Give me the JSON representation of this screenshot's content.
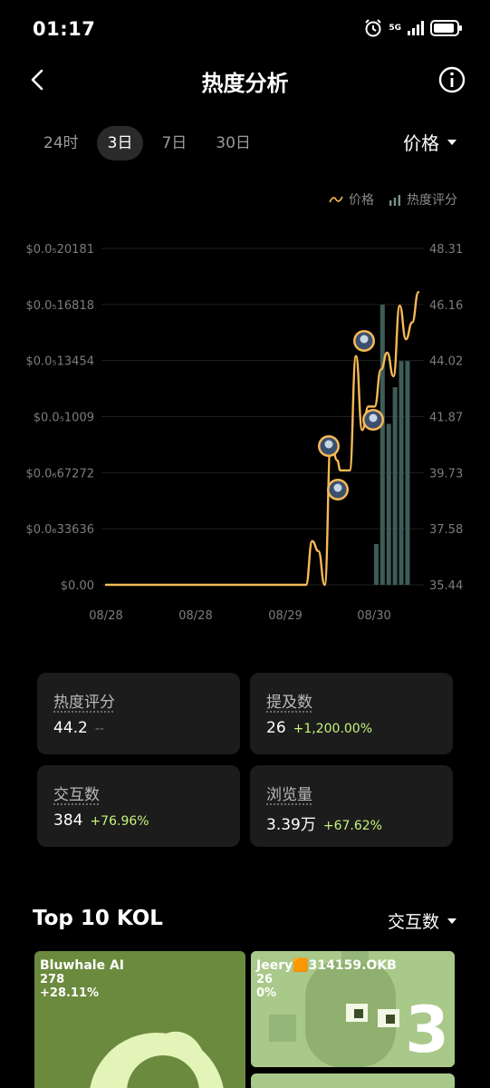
{
  "status_bar": {
    "time": "01:17",
    "network": "5G"
  },
  "header": {
    "title": "热度分析"
  },
  "tabs": [
    "24时",
    "3日",
    "7日",
    "30日"
  ],
  "active_tab": "3日",
  "price_select": {
    "label": "价格"
  },
  "legend": {
    "price": "价格",
    "heat": "热度评分"
  },
  "colors": {
    "price_line": "#F7B955",
    "heat_bar": "#3E5C57",
    "positive": "#C5F37A",
    "kol_card_1": "#6B8A3D",
    "kol_card_2": "#A9C98A"
  },
  "chart_data": {
    "type": "line",
    "x_tick_labels": [
      "08/28",
      "08/28",
      "08/29",
      "08/30"
    ],
    "y_left_labels": [
      "$0.0₅20181",
      "$0.0₅16818",
      "$0.0₅13454",
      "$0.0₅1009",
      "$0.0₆67272",
      "$0.0₆33636",
      "$0.00"
    ],
    "y_right_labels": [
      "48.31",
      "46.16",
      "44.02",
      "41.87",
      "39.73",
      "37.58",
      "35.44"
    ],
    "y_right_range": [
      35.44,
      48.31
    ],
    "price_series": {
      "name": "价格",
      "t": [
        0,
        0.1,
        0.2,
        0.3,
        0.4,
        0.5,
        0.6,
        0.64,
        0.66,
        0.68,
        0.7,
        0.72,
        0.74,
        0.75,
        0.76,
        0.78,
        0.8,
        0.82,
        0.84,
        0.86,
        0.88,
        0.9,
        0.92,
        0.94,
        0.96,
        0.98,
        1.0
      ],
      "v": [
        0,
        0,
        0,
        0,
        0,
        0,
        0,
        0,
        0.13,
        0.1,
        0,
        0.43,
        0.37,
        0.34,
        0.34,
        0.34,
        0.68,
        0.46,
        0.53,
        0.53,
        0.64,
        0.69,
        0.62,
        0.83,
        0.73,
        0.78,
        0.87
      ]
    },
    "heat_series": {
      "name": "热度评分",
      "t": [
        0.865,
        0.885,
        0.905,
        0.925,
        0.945,
        0.965
      ],
      "v": [
        37.0,
        46.16,
        41.6,
        43.0,
        44.0,
        44.0
      ]
    }
  },
  "stats": [
    {
      "label": "热度评分",
      "value": "44.2",
      "change": "--"
    },
    {
      "label": "提及数",
      "value": "26",
      "change": "+1,200.00%"
    },
    {
      "label": "交互数",
      "value": "384",
      "change": "+76.96%"
    },
    {
      "label": "浏览量",
      "value": "3.39万",
      "change": "+67.62%"
    }
  ],
  "kol": {
    "title": "Top 10 KOL",
    "sort_label": "交互数",
    "cards": [
      {
        "name": "Bluwhale AI",
        "count": "278",
        "change": "+28.11%"
      },
      {
        "name": "Jeery🟧314159.OKB",
        "count": "26",
        "change": "0%",
        "rank": "3"
      }
    ]
  }
}
